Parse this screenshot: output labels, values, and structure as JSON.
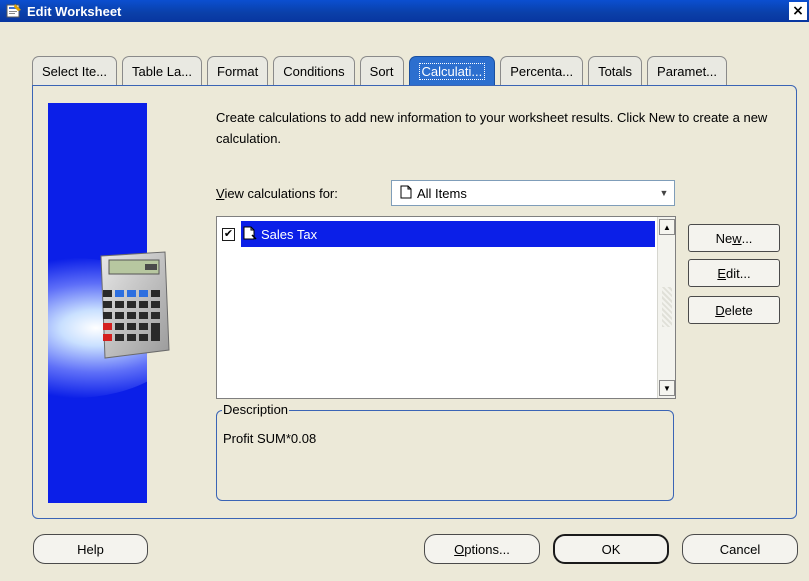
{
  "window": {
    "title": "Edit Worksheet",
    "close_glyph": "×"
  },
  "tabs": [
    {
      "label": "Select Ite..."
    },
    {
      "label": "Table La..."
    },
    {
      "label": "Format"
    },
    {
      "label": "Conditions"
    },
    {
      "label": "Sort"
    },
    {
      "label": "Calculati...",
      "active": true
    },
    {
      "label": "Percenta..."
    },
    {
      "label": "Totals"
    },
    {
      "label": "Paramet..."
    }
  ],
  "main": {
    "instructions": "Create calculations to add new information to your worksheet results.  Click New to create a new calculation.",
    "view_label_accel": "V",
    "view_label_rest": "iew calculations for:",
    "view_select_value": "All Items",
    "calculations": [
      {
        "name": "Sales Tax",
        "checked": true,
        "selected": true
      }
    ],
    "description_legend": "Description",
    "description_text": "Profit SUM*0.08"
  },
  "side_buttons": {
    "new_pre": "Ne",
    "new_acc": "w",
    "new_post": "...",
    "edit_acc": "E",
    "edit_post": "dit...",
    "delete_acc": "D",
    "delete_post": "elete"
  },
  "footer": {
    "help_label": "Help",
    "options_acc": "O",
    "options_post": "ptions...",
    "ok_label": "OK",
    "cancel_label": "Cancel"
  },
  "colors": {
    "title_bar": "#0a3fa8",
    "active_tab": "#2c6fcf",
    "selection": "#0b1fe8",
    "side_image": "#0b1fe8"
  }
}
